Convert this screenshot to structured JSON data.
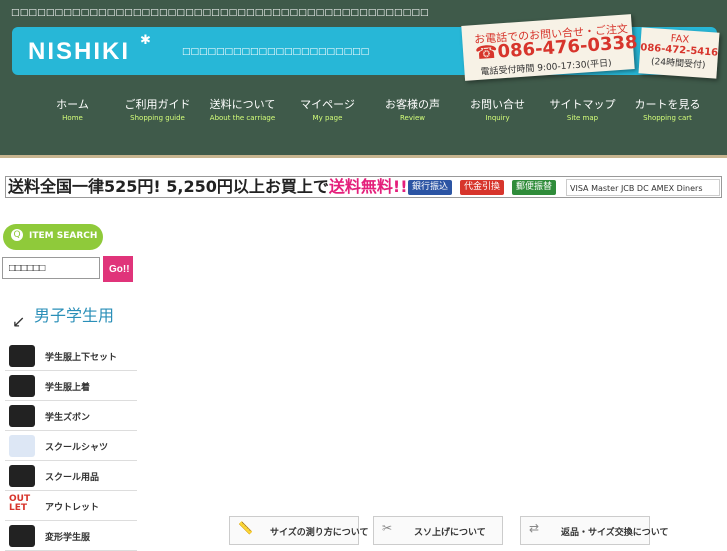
{
  "header": {
    "top_text": "□□□□□□□□□□□□□□□□□□□□□□□□□□□□□□□□□□□□□□□□□□□□□□□□",
    "logo_text": "NISHIKI",
    "tagline": "□□□□□□□□□□□□□□□□□□□□□□",
    "phone": {
      "title": "お電話でのお問い合せ・ご注文",
      "number": "☎086-476-0338",
      "hours": "電話受付時間 9:00-17:30(平日)"
    },
    "fax": {
      "label": "FAX",
      "number": "086-472-5416",
      "hours": "(24時間受付)"
    },
    "nav": [
      {
        "jp": "ホーム",
        "en": "Home",
        "icon": "home-icon"
      },
      {
        "jp": "ご利用ガイド",
        "en": "Shopping guide",
        "icon": "guide-icon"
      },
      {
        "jp": "送料について",
        "en": "About the carriage",
        "icon": "truck-icon"
      },
      {
        "jp": "マイページ",
        "en": "My page",
        "icon": "person-icon"
      },
      {
        "jp": "お客様の声",
        "en": "Review",
        "icon": "review-icon"
      },
      {
        "jp": "お問い合せ",
        "en": "Inquiry",
        "icon": "mail-icon"
      },
      {
        "jp": "サイトマップ",
        "en": "Site map",
        "icon": "sitemap-icon"
      },
      {
        "jp": "カートを見る",
        "en": "Shopping cart",
        "icon": "cart-icon"
      }
    ]
  },
  "banner": {
    "shipping_text": "送料全国一律525円! 5,250円以上お買上で",
    "free_text": "送料無料!!",
    "payments": [
      "銀行振込",
      "代金引換",
      "郵便振替"
    ],
    "cards": "VISA Master JCB DC AMEX Diners"
  },
  "sidebar": {
    "search_title": "ITEM SEARCH",
    "search_value": "□□□□□□",
    "go_label": "Go!!",
    "section_title": "男子学生用",
    "categories": [
      {
        "label": "学生服上下セット"
      },
      {
        "label": "学生服上着"
      },
      {
        "label": "学生ズボン"
      },
      {
        "label": "スクールシャツ"
      },
      {
        "label": "スクール用品"
      },
      {
        "label": "アウトレット"
      },
      {
        "label": "変形学生服"
      }
    ]
  },
  "info_boxes": [
    {
      "label": "サイズの測り方について"
    },
    {
      "label": "スソ上げについて"
    },
    {
      "label": "返品・サイズ交換について"
    }
  ],
  "colors": {
    "chalkboard": "#3f5a4a",
    "logo_bar": "#27b7d7",
    "accent_pink": "#e41f7b",
    "accent_green": "#8fca3a",
    "phone_red": "#d7352c"
  }
}
